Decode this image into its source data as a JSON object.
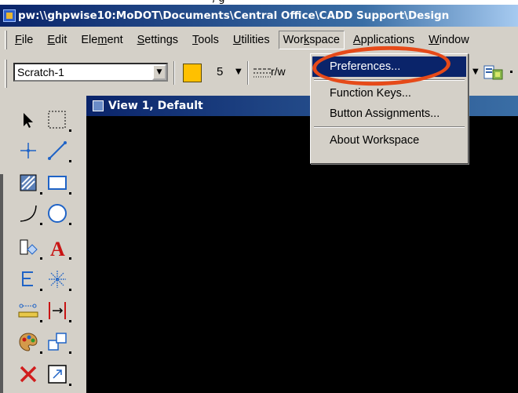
{
  "window": {
    "top_caption_fragment": ", g",
    "title": "pw:\\\\ghpwise10:MoDOT\\Documents\\Central Office\\CADD Support\\Design"
  },
  "menubar": {
    "items": [
      "File",
      "Edit",
      "Element",
      "Settings",
      "Tools",
      "Utilities",
      "Workspace",
      "Applications",
      "Window"
    ],
    "active": "Workspace"
  },
  "toolbar": {
    "level_value": "Scratch-1",
    "color_hex": "#ffc000",
    "weight_value": "5",
    "style_suffix": "r/w"
  },
  "view": {
    "title": "View 1, Default"
  },
  "workspace_menu": {
    "items": [
      {
        "label": "Preferences...",
        "highlighted": true
      },
      {
        "label": "Function Keys..."
      },
      {
        "label": "Button Assignments..."
      },
      {
        "label": "About Workspace"
      }
    ]
  },
  "tools": [
    "element-selection-icon",
    "fence-icon",
    "place-point-icon",
    "place-line-icon",
    "patterning-icon",
    "place-rectangle-icon",
    "place-arc-icon",
    "place-circle-icon",
    "cell-icon",
    "place-text-icon",
    "dimension-icon",
    "point-array-icon",
    "measure-distance-icon",
    "modify-element-icon",
    "change-attributes-icon",
    "copy-element-icon",
    "delete-element-icon",
    "scale-element-icon"
  ],
  "colors": {
    "titlebar": "#0a246a",
    "menu_highlight": "#0a246a",
    "view_background": "#000000",
    "annotation_ring": "#e64a19",
    "active_color_swatch": "#ffc000"
  }
}
